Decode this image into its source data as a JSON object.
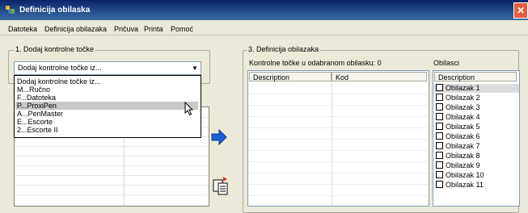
{
  "window": {
    "title": "Definicija obilaska",
    "close_glyph": "✕"
  },
  "menu": [
    "Datoteka",
    "Definicija obilazaka",
    "Pričuva",
    "Printa",
    "Pomoć"
  ],
  "section1": {
    "label": "1. Dodaj kontrolne točke",
    "combo_value": "Dodaj kontrolne točke iz...",
    "options": [
      "Dodaj kontrolne točke iz...",
      "M...Ručno",
      "F...Datoteka",
      "P...ProxiPen",
      "A...PenMaster",
      "E...Escorte",
      "2...Escorte II"
    ],
    "selected_option": "P...ProxiPen"
  },
  "section3": {
    "label": "3. Definicija obilazaka",
    "count_label": "Kontrolne točke u odabranom obilasku: 0",
    "columns": [
      "Description",
      "Kod"
    ]
  },
  "tours": {
    "label": "Obilasci",
    "column": "Description",
    "items": [
      "Obilazak 1",
      "Obilazak 2",
      "Obilazak 3",
      "Obilazak 4",
      "Obilazak 5",
      "Obilazak 6",
      "Obilazak 7",
      "Obilazak 8",
      "Obilazak 9",
      "Obilazak 10",
      "Obilazak 11"
    ],
    "selected": "Obilazak 1"
  },
  "icons": {
    "app": "app-icon",
    "add_arrow": "right-arrow-icon",
    "paste": "paste-icon",
    "cursor": "mouse-pointer-icon"
  },
  "colors": {
    "title_bar": "#0a246a",
    "arrow": "#1a5fd6",
    "close": "#e35d3f"
  }
}
